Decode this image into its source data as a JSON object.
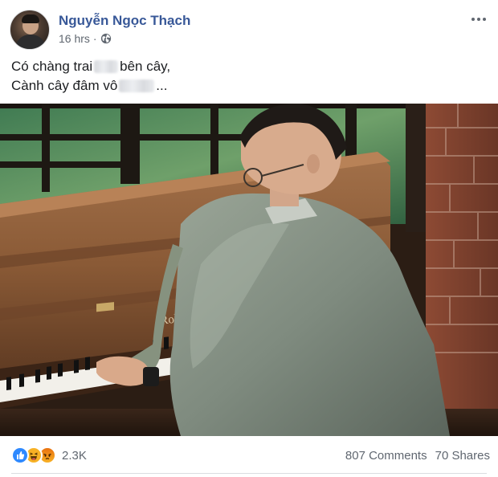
{
  "post": {
    "author": "Nguyễn Ngọc Thạch",
    "time": "16 hrs",
    "separator": "·",
    "privacy_icon": "globe-icon",
    "more_icon": "more-options-icon",
    "text": {
      "line1_before": "Có chàng trai",
      "line1_after": "bên cây,",
      "line2_before": "Cành cây đâm vô",
      "line2_after": "..."
    },
    "photo_alt": "Man in a grey jacket playing a Roland upright piano",
    "piano_brand": "Roland"
  },
  "footer": {
    "reaction_icons": [
      "like-icon",
      "haha-icon",
      "angry-icon"
    ],
    "reaction_count": "2.3K",
    "comments": "807 Comments",
    "shares": "70 Shares"
  },
  "colors": {
    "author_link": "#385898",
    "meta_text": "#606770",
    "like_blue": "#2e89ff",
    "reaction_yellow": "#f7b125"
  }
}
